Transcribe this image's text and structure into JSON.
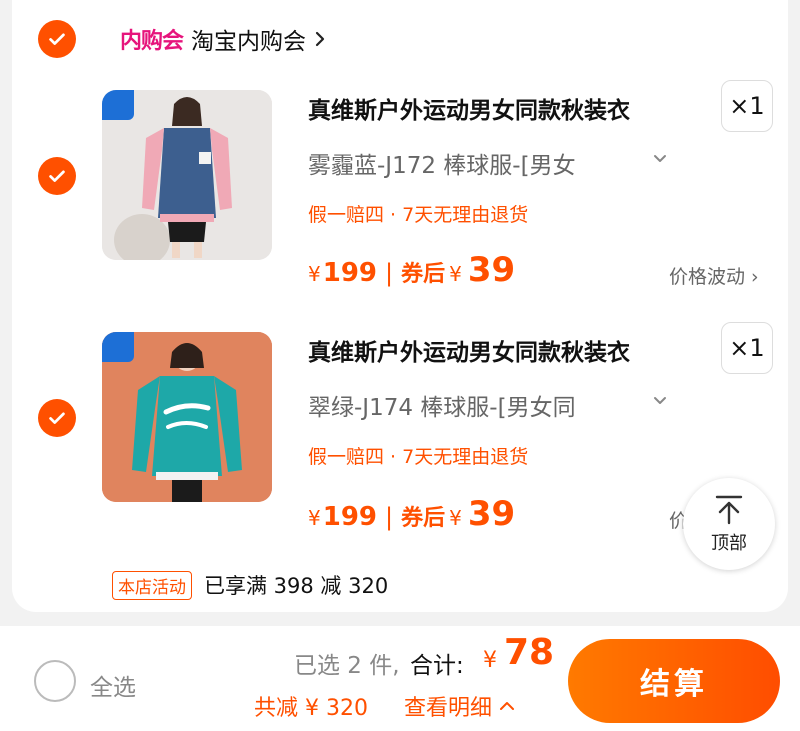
{
  "shop": {
    "logo_text": "内购会",
    "name": "淘宝内购会"
  },
  "items": [
    {
      "title": "真维斯户外运动男女同款秋装衣",
      "quantity": "×1",
      "variant": "雾霾蓝-J172 棒球服-[男女",
      "promise": "假一赔四 · 7天无理由退货",
      "price_yen": "¥",
      "price": "199",
      "after_coupon_label": "券后",
      "after_yen": "¥",
      "after_coupon_price": "39",
      "fluctuation": "价格波动",
      "colors": {
        "jacket": "#3d5f8f",
        "sleeve": "#f0a9b6",
        "bg": "#e9e6e4"
      }
    },
    {
      "title": "真维斯户外运动男女同款秋装衣",
      "quantity": "×1",
      "variant": "翠绿-J174 棒球服-[男女同",
      "promise": "假一赔四 · 7天无理由退货",
      "price_yen": "¥",
      "price": "199",
      "after_coupon_label": "券后",
      "after_yen": "¥",
      "after_coupon_price": "39",
      "fluctuation": "价格波动",
      "colors": {
        "jacket": "#1ea8a8",
        "sleeve": "#1ea8a8",
        "bg": "#e0845e"
      }
    }
  ],
  "promo": {
    "tag": "本店活动",
    "text": "已享满 398 减 320"
  },
  "back_to_top": {
    "label": "顶部"
  },
  "footer": {
    "select_all": "全选",
    "selected_count": "已选 2 件,",
    "total_label": "合计:",
    "total_yen": "¥",
    "total_value": "78",
    "saved": "共减 ¥ 320",
    "detail": "查看明细",
    "checkout": "结算"
  },
  "accent_color": "#ff5000"
}
